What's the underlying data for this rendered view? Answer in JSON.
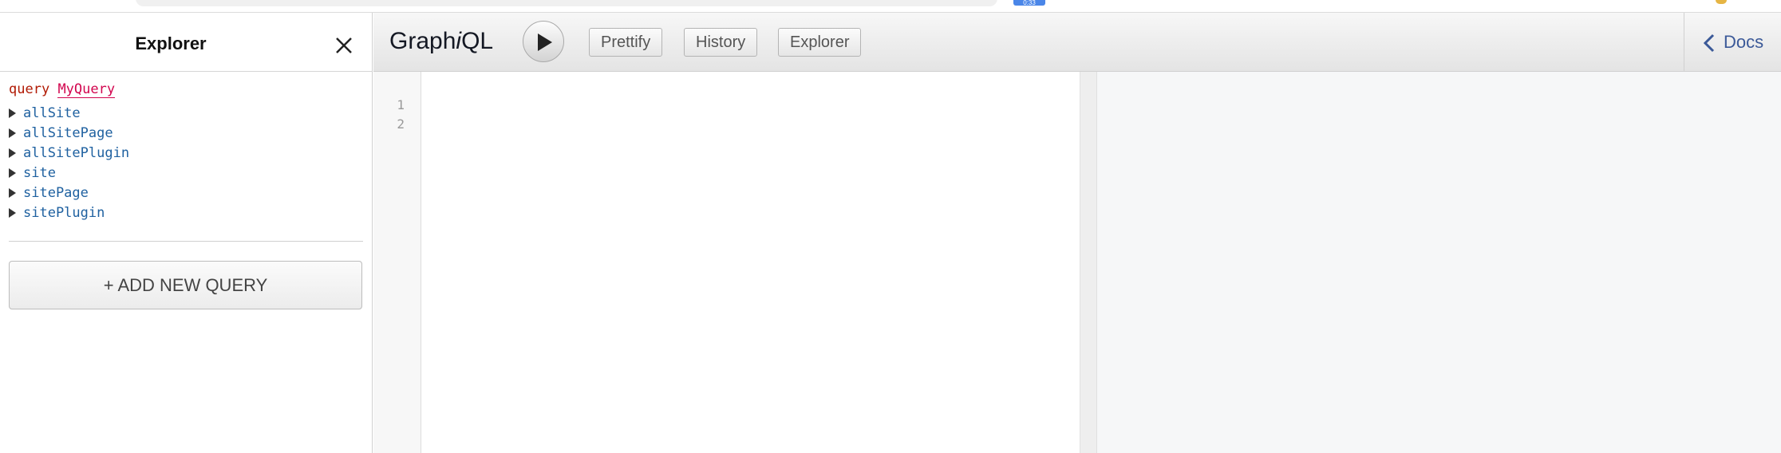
{
  "browser": {
    "badge_text": "0:33"
  },
  "explorer": {
    "title": "Explorer",
    "query_keyword": "query",
    "query_name": "MyQuery",
    "fields": [
      "allSite",
      "allSitePage",
      "allSitePlugin",
      "site",
      "sitePage",
      "sitePlugin"
    ],
    "add_query_label": "+ ADD NEW QUERY"
  },
  "toolbar": {
    "brand_prefix": "Graph",
    "brand_italic": "i",
    "brand_suffix": "QL",
    "prettify_label": "Prettify",
    "history_label": "History",
    "explorer_label": "Explorer",
    "docs_label": "Docs"
  },
  "editor": {
    "line_numbers": [
      "1",
      "2"
    ]
  },
  "icons": {
    "close": "close-icon",
    "run": "play-icon",
    "docs": "chevron-left-icon",
    "field_toggle": "triangle-right-icon"
  },
  "colors": {
    "keyword": "#b11a04",
    "query_name": "#d2054e",
    "field": "#1f61a0",
    "docs_link": "#3b5998"
  }
}
